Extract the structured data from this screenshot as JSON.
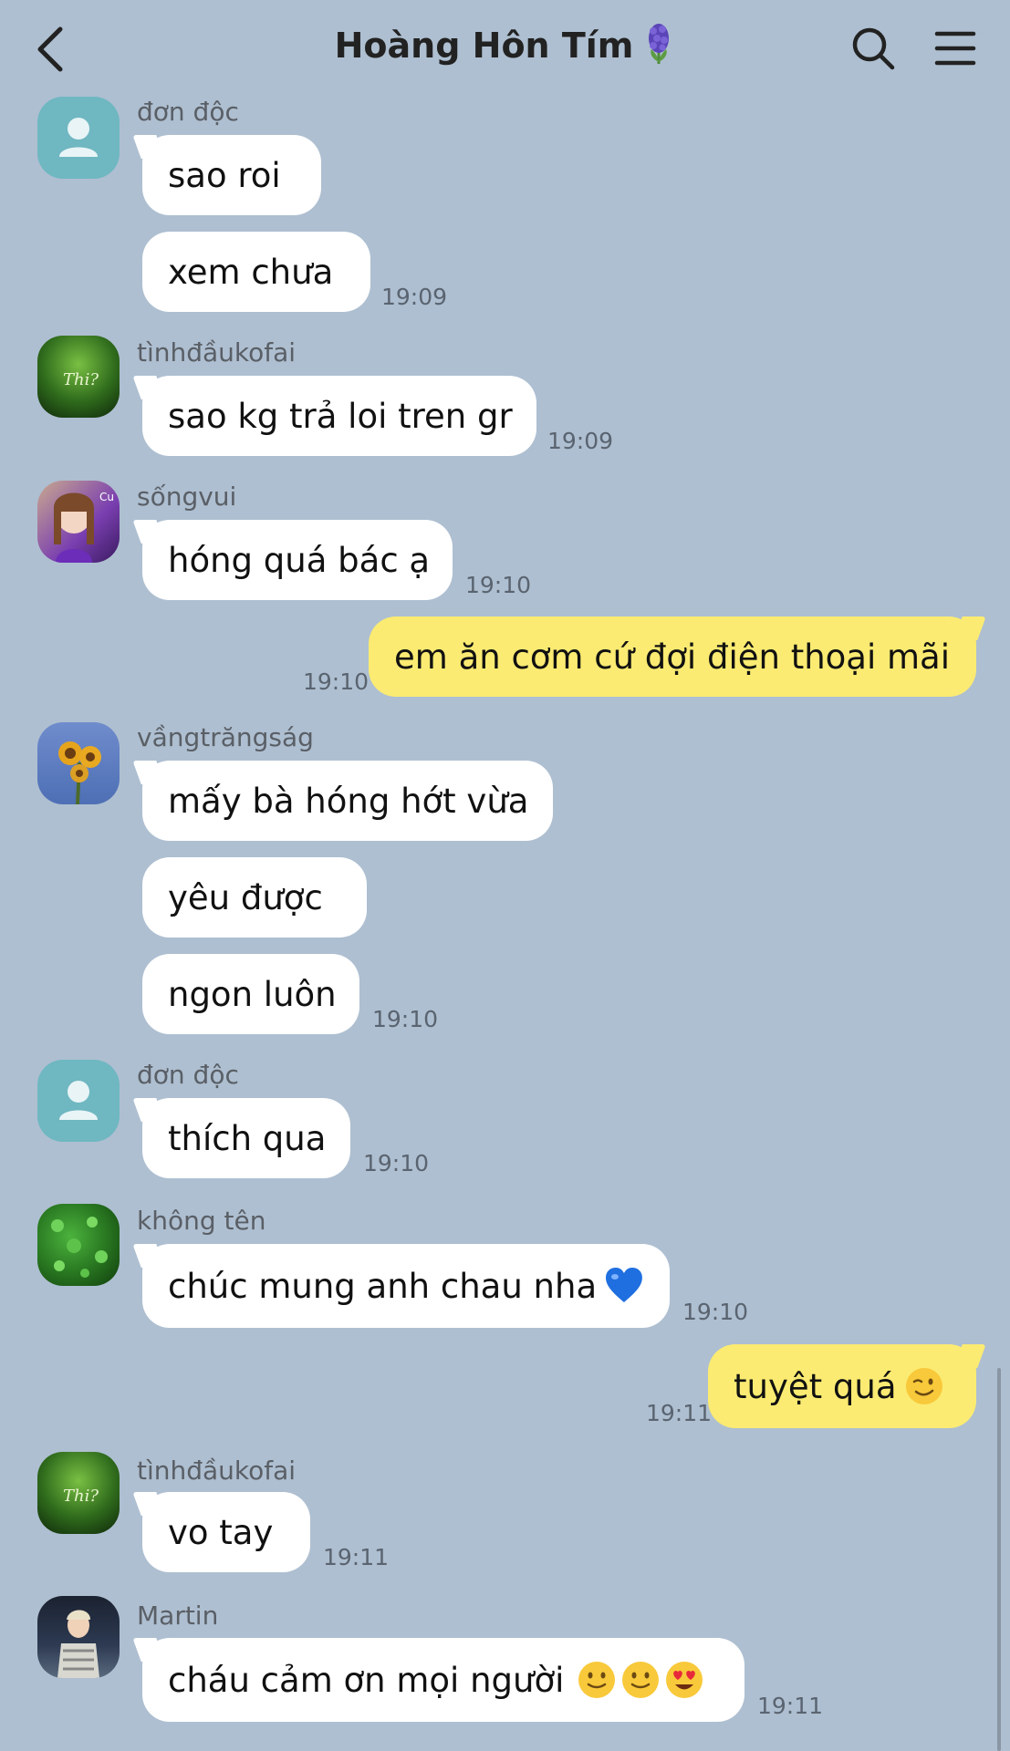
{
  "header": {
    "title": "Hoàng Hôn Tím",
    "title_icon": "hyacinth-emoji",
    "back_icon": "chevron-left-icon",
    "search_icon": "search-icon",
    "menu_icon": "hamburger-menu-icon"
  },
  "messages": [
    {
      "sender": "đơn độc",
      "bubbles": [
        "sao roi",
        "xem chưa"
      ],
      "time": "19:09"
    },
    {
      "sender": "tìnhđầukofai",
      "bubbles": [
        "sao kg trả loi tren gr"
      ],
      "time": "19:09"
    },
    {
      "sender": "sốngvui",
      "bubbles": [
        "hóng quá bác ạ"
      ],
      "time": "19:10"
    },
    {
      "sender": "me",
      "bubbles": [
        "em ăn cơm cứ đợi điện thoại mãi"
      ],
      "time": "19:10"
    },
    {
      "sender": "vầngtrăngság",
      "bubbles": [
        "mấy bà hóng hớt vừa",
        "yêu được",
        "ngon luôn"
      ],
      "time": "19:10"
    },
    {
      "sender": "đơn độc",
      "bubbles": [
        "thích qua"
      ],
      "time": "19:10"
    },
    {
      "sender": "không tên",
      "bubbles": [
        "chúc mung anh chau nha"
      ],
      "emoji": [
        "blue-heart-emoji"
      ],
      "time": "19:10"
    },
    {
      "sender": "me",
      "bubbles": [
        "tuyệt quá"
      ],
      "emoji": [
        "winking-face-emoji"
      ],
      "time": "19:11"
    },
    {
      "sender": "tìnhđầukofai",
      "bubbles": [
        "vo tay"
      ],
      "time": "19:11"
    },
    {
      "sender": "Martin",
      "bubbles": [
        "cháu cảm ơn mọi người"
      ],
      "emoji": [
        "slightly-smiling-face-emoji",
        "slightly-smiling-face-emoji",
        "heart-eyes-emoji"
      ],
      "time": "19:11"
    }
  ],
  "colors": {
    "background": "#aebfd1",
    "incoming_bubble": "#ffffff",
    "outgoing_bubble": "#fbeb72",
    "default_avatar": "#6fb7c1"
  }
}
